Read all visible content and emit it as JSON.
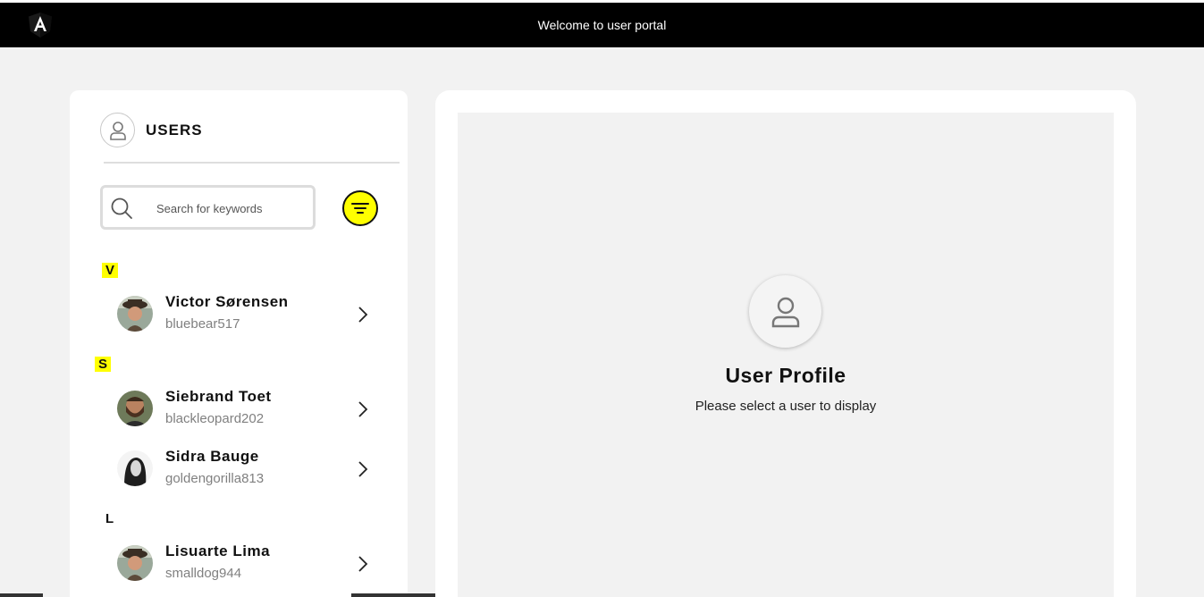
{
  "header": {
    "title": "Welcome to user portal",
    "logo_icon": "angular-logo-icon",
    "background": "#000000"
  },
  "users_panel": {
    "title": "USERS",
    "header_icon": "user-icon",
    "search": {
      "placeholder": "Search for keywords",
      "value": "",
      "icon": "search-icon"
    },
    "filter_button": {
      "icon": "filter-icon",
      "color": "#ffff00"
    },
    "groups": [
      {
        "letter": "V",
        "highlighted": true,
        "users": [
          {
            "name": "Victor Sørensen",
            "username": "bluebear517"
          }
        ]
      },
      {
        "letter": "S",
        "highlighted": true,
        "users": [
          {
            "name": "Siebrand Toet",
            "username": "blackleopard202"
          },
          {
            "name": "Sidra Bauge",
            "username": "goldengorilla813"
          }
        ]
      },
      {
        "letter": "L",
        "highlighted": false,
        "users": [
          {
            "name": "Lisuarte Lima",
            "username": "smalldog944"
          }
        ]
      }
    ]
  },
  "profile_panel": {
    "title": "User Profile",
    "subtitle": "Please select a user to display",
    "icon": "user-icon"
  },
  "colors": {
    "highlight": "#ffff00",
    "page_background": "#f2f2f2"
  }
}
